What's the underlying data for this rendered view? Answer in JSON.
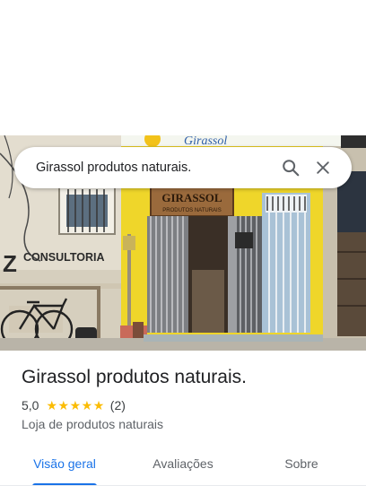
{
  "search": {
    "query": "Girassol produtos naturais.",
    "search_icon": "search-icon",
    "close_icon": "close-icon"
  },
  "place": {
    "name": "Girassol produtos naturais.",
    "rating": "5,0",
    "stars": 5,
    "review_count": "(2)",
    "category": "Loja de produtos naturais"
  },
  "tabs": [
    {
      "label": "Visão geral",
      "active": true
    },
    {
      "label": "Avaliações",
      "active": false
    },
    {
      "label": "Sobre",
      "active": false
    }
  ],
  "colors": {
    "accent": "#1a73e8",
    "star": "#fbbc04",
    "text_primary": "#202124",
    "text_secondary": "#5f6368"
  }
}
